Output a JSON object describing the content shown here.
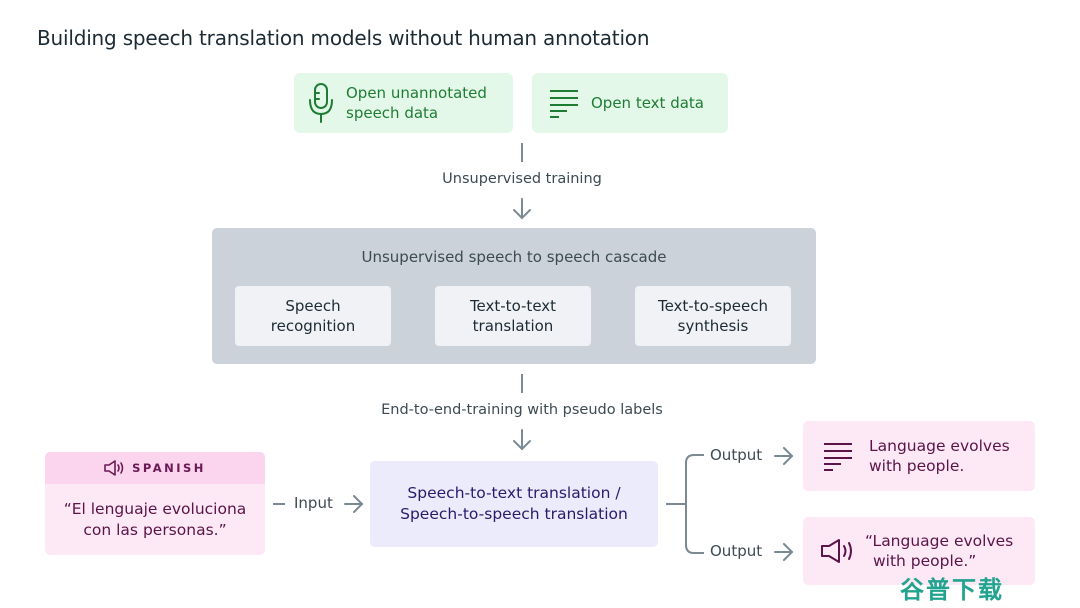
{
  "title": "Building speech translation models without human annotation",
  "sources": [
    {
      "icon": "microphone-icon",
      "label_line1": "Open unannotated",
      "label_line2": "speech data"
    },
    {
      "icon": "text-lines-icon",
      "label": "Open text data"
    }
  ],
  "step1_label": "Unsupervised training",
  "cascade": {
    "title": "Unsupervised speech to speech cascade",
    "stages": [
      {
        "line1": "Speech",
        "line2": "recognition"
      },
      {
        "line1": "Text-to-text",
        "line2": "translation"
      },
      {
        "line1": "Text-to-speech",
        "line2": "synthesis"
      }
    ]
  },
  "step2_label": "End-to-end-training with pseudo labels",
  "input": {
    "language": "SPANISH",
    "line1": "“El lenguaje evoluciona",
    "line2": "con las personas.”",
    "connector": "Input"
  },
  "model": {
    "line1": "Speech-to-text translation /",
    "line2": "Speech-to-speech translation"
  },
  "outputs": [
    {
      "connector": "Output",
      "icon": "text-lines-icon",
      "line1": "Language evolves",
      "line2": "with people."
    },
    {
      "connector": "Output",
      "icon": "speaker-icon",
      "line1": "“Language evolves",
      "line2": "with people.”"
    }
  ],
  "watermark": "谷普下载",
  "colors": {
    "green_bg": "#e3f8e9",
    "green_text": "#1f7d33",
    "cascade_bg": "#cbd2d9",
    "stage_bg": "#f0f2f5",
    "model_bg": "#ebebfb",
    "model_text": "#2b1a6b",
    "pink_bg": "#fde8f5",
    "pink_head": "#fbd4ee",
    "pink_text": "#5a1448",
    "connector": "#7b8a92"
  }
}
